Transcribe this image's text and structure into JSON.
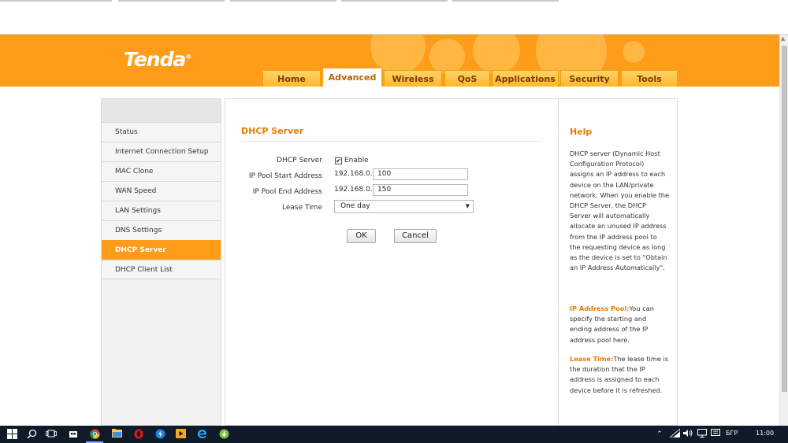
{
  "header": {
    "logo": "Tenda",
    "logo_mark": "®",
    "tabs": [
      {
        "label": "Home"
      },
      {
        "label": "Advanced",
        "active": true
      },
      {
        "label": "Wireless"
      },
      {
        "label": "QoS"
      },
      {
        "label": "Applications"
      },
      {
        "label": "Security"
      },
      {
        "label": "Tools"
      }
    ]
  },
  "sidebar": {
    "items": [
      {
        "label": "Status"
      },
      {
        "label": "Internet Connection Setup"
      },
      {
        "label": "MAC Clone"
      },
      {
        "label": "WAN Speed"
      },
      {
        "label": "LAN Settings"
      },
      {
        "label": "DNS Settings"
      },
      {
        "label": "DHCP Server",
        "active": true
      },
      {
        "label": "DHCP Client List"
      }
    ]
  },
  "main": {
    "title": "DHCP Server",
    "dhcp_server_label": "DHCP Server",
    "enable_checked": true,
    "enable_label": "Enable",
    "pool_start_label": "IP Pool Start Address",
    "pool_start_prefix": "192.168.0.",
    "pool_start_value": "100",
    "pool_end_label": "IP Pool End Address",
    "pool_end_prefix": "192.168.0.",
    "pool_end_value": "150",
    "lease_label": "Lease Time",
    "lease_value": "One day",
    "ok_label": "OK",
    "cancel_label": "Cancel"
  },
  "help": {
    "title": "Help",
    "intro": "DHCP server (Dynamic Host Configuration Protocol) assigns an IP address to each device on the LAN/private network. When you enable the DHCP Server, the DHCP Server will automatically allocate an unused IP address from the IP address pool to the requesting device as long as the device is set to \"Obtain an IP Address Automatically\".",
    "pool_term": "IP Address Pool:",
    "pool_text": "You can specify the starting and ending address of the IP address pool here.",
    "lease_term": "Lease Time:",
    "lease_text": "The lease time is the duration that the IP address is assigned to each device before it is refreshed."
  },
  "taskbar": {
    "language": "БГР",
    "clock": "11:00",
    "icons": [
      "windows-start-icon",
      "search-icon",
      "task-view-icon",
      "store-icon",
      "chrome-icon",
      "file-explorer-icon",
      "opera-icon",
      "edge-legacy-icon",
      "media-player-icon",
      "edge-icon",
      "torrent-icon"
    ]
  },
  "colors": {
    "brand_orange": "#ff9c19",
    "accent_text": "#e87c00",
    "taskbar": "#101b2a"
  }
}
